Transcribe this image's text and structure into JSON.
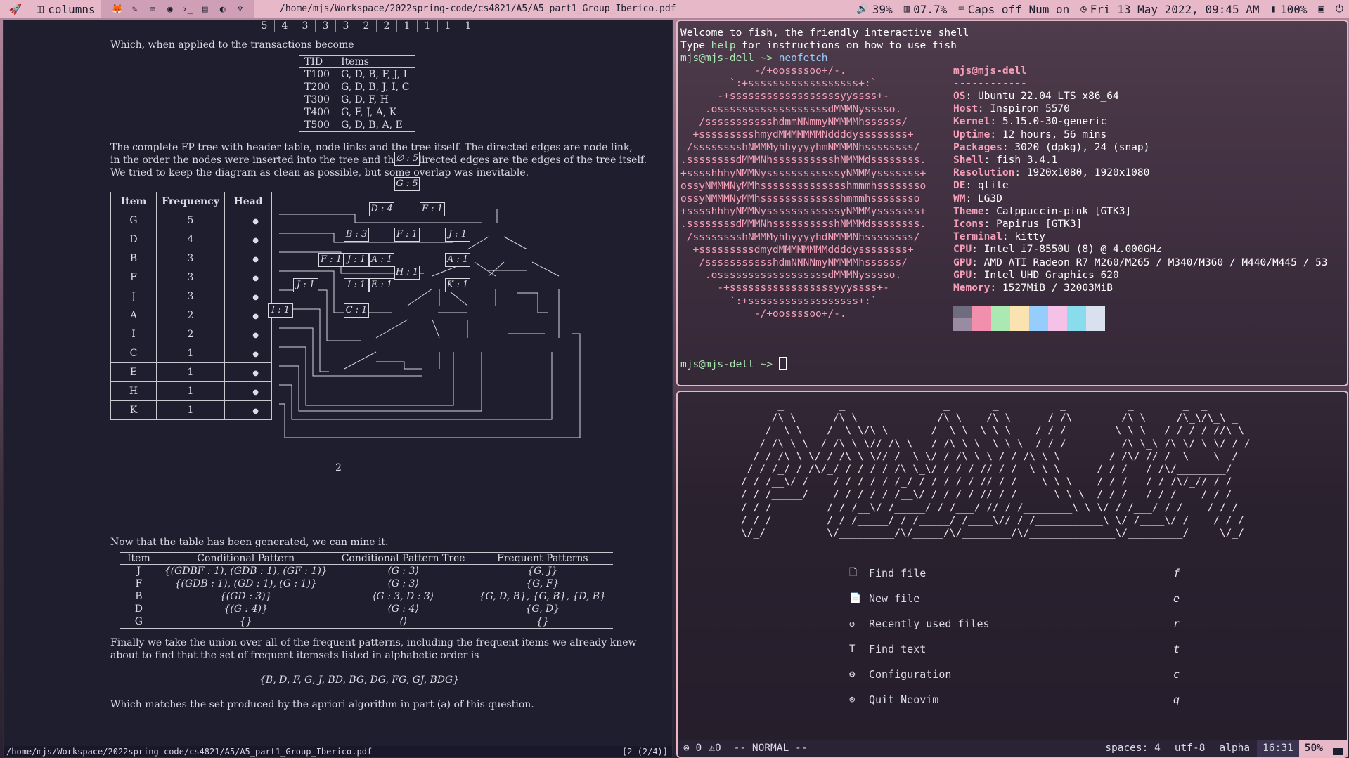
{
  "topbar": {
    "layout": "columns",
    "window_title": "/home/mjs/Workspace/2022spring-code/cs4821/A5/A5_part1_Group_Iberico.pdf",
    "volume": "39%",
    "memory": "07.7%",
    "locks": "Caps off Num on",
    "clock": "Fri 13 May 2022, 09:45 AM",
    "battery": "100%"
  },
  "pdf": {
    "strip_numbers": [
      "5",
      "4",
      "3",
      "3",
      "3",
      "2",
      "2",
      "1",
      "1",
      "1",
      "1"
    ],
    "p_intro": "Which, when applied to the transactions become",
    "tid_header": [
      "TID",
      "Items"
    ],
    "tid_rows": [
      [
        "T100",
        "G, D, B, F, J, I"
      ],
      [
        "T200",
        "G, D, B, J, I, C"
      ],
      [
        "T300",
        "G, D, F, H"
      ],
      [
        "T400",
        "G, F, J, A, K"
      ],
      [
        "T500",
        "G, D, B, A, E"
      ]
    ],
    "p_tree_1": "The complete FP tree with header table, node links and the tree itself.  The directed edges are node link,",
    "p_tree_2": "in the order the nodes were inserted into the tree and the undirected edges are the edges of the tree itself.",
    "p_tree_3": "We tried to keep the diagram as clean as possible, but some overlap was inevitable.",
    "header_table": {
      "cols": [
        "Item",
        "Frequency",
        "Head"
      ],
      "rows": [
        [
          "G",
          "5"
        ],
        [
          "D",
          "4"
        ],
        [
          "B",
          "3"
        ],
        [
          "F",
          "3"
        ],
        [
          "J",
          "3"
        ],
        [
          "A",
          "2"
        ],
        [
          "I",
          "2"
        ],
        [
          "C",
          "1"
        ],
        [
          "E",
          "1"
        ],
        [
          "H",
          "1"
        ],
        [
          "K",
          "1"
        ]
      ]
    },
    "tree_nodes": {
      "root": "∅ : 5",
      "g5": "G : 5",
      "d4": "D : 4",
      "f1a": "F : 1",
      "b3": "B : 3",
      "f1b": "F : 1",
      "j1a": "J : 1",
      "f1c": "F : 1",
      "j1b": "J : 1",
      "a1a": "A : 1",
      "a1b": "A : 1",
      "h1": "H : 1",
      "j1c": "J : 1",
      "i1a": "I : 1",
      "e1": "E : 1",
      "k1": "K : 1",
      "i1b": "I : 1",
      "c1": "C : 1"
    },
    "page_number": "2",
    "p_mine": "Now that the table has been generated, we can mine it.",
    "mine_header": [
      "Item",
      "Conditional Pattern",
      "Conditional Pattern Tree",
      "Frequent Patterns"
    ],
    "mine_rows": [
      [
        "J",
        "{(GDBF : 1), (GDB : 1), (GF : 1)}",
        "⟨G : 3⟩",
        "{G, J}"
      ],
      [
        "F",
        "{(GDB : 1), (GD : 1), (G : 1)}",
        "⟨G : 3⟩",
        "{G, F}"
      ],
      [
        "B",
        "{(GD : 3)}",
        "⟨G : 3, D : 3⟩",
        "{G, D, B}, {G, B}, {D, B}"
      ],
      [
        "D",
        "{(G : 4)}",
        "⟨G : 4⟩",
        "{G, D}"
      ],
      [
        "G",
        "{}",
        "⟨⟩",
        "{}"
      ]
    ],
    "p_final_1": "Finally we take the union over all of the frequent patterns, including the frequent items we already knew",
    "p_final_2": "about to find that the set of frequent itemsets listed in alphabetic order is",
    "final_set": "{B, D, F, G, J, BD, BG, DG, FG, GJ, BDG}",
    "p_match": "Which matches the set produced by the apriori algorithm in part (a) of this question.",
    "status_path": "/home/mjs/Workspace/2022spring-code/cs4821/A5/A5_part1_Group_Iberico.pdf",
    "status_page": "[2 (2/4)]"
  },
  "terminal": {
    "welcome": "Welcome to fish, the friendly interactive shell",
    "help_pre": "Type ",
    "help_word": "help",
    "help_post": " for instructions on how to use fish",
    "prompt": "mjs@mjs-dell ~> ",
    "command": "neofetch",
    "art": [
      "            -/+oossssoo+/-.",
      "        `:+ssssssssssssssssss+:`",
      "      -+ssssssssssssssssssyyssss+-",
      "    .ossssssssssssssssssdMMMNysssso.",
      "   /ssssssssssshdmmNNmmyNMMMMhssssss/",
      "  +ssssssssshmydMMMMMMMNddddyssssssss+",
      " /sssssssshNMMMyhhyyyyhmNMMMNhssssssss/",
      ".ssssssssdMMMNhsssssssssshNMMMdssssssss.",
      "+sssshhhyNMMNyssssssssssssyNMMMysssssss+",
      "ossyNMMMNyMMhsssssssssssssshmmmhssssssso",
      "ossyNMMMNyMMhssssssssssssshmmmhssssssso",
      "+sssshhhyNMMNyssssssssssssyNMMMysssssss+",
      ".ssssssssdMMMNhsssssssssshNMMMdssssssss.",
      " /sssssssshNMMMyhhyyyyhdNMMMNhssssssss/",
      "  +sssssssssdmydMMMMMMMMddddyssssssss+",
      "   /ssssssssssshdmNNNNmyNMMMMhssssss/",
      "    .ossssssssssssssssssdMMMNysssso.",
      "      -+sssssssssssssssssyyyssss+-",
      "        `:+ssssssssssssssssss+:`",
      "            -/+oossssoo+/-."
    ],
    "user_host": "mjs@mjs-dell",
    "sep": "------------",
    "info": [
      {
        "k": "OS",
        "v": "Ubuntu 22.04 LTS x86_64"
      },
      {
        "k": "Host",
        "v": "Inspiron 5570"
      },
      {
        "k": "Kernel",
        "v": "5.15.0-30-generic"
      },
      {
        "k": "Uptime",
        "v": "12 hours, 56 mins"
      },
      {
        "k": "Packages",
        "v": "3020 (dpkg), 24 (snap)"
      },
      {
        "k": "Shell",
        "v": "fish 3.4.1"
      },
      {
        "k": "Resolution",
        "v": "1920x1080, 1920x1080"
      },
      {
        "k": "DE",
        "v": "qtile"
      },
      {
        "k": "WM",
        "v": "LG3D"
      },
      {
        "k": "Theme",
        "v": "Catppuccin-pink [GTK3]"
      },
      {
        "k": "Icons",
        "v": "Papirus [GTK3]"
      },
      {
        "k": "Terminal",
        "v": "kitty"
      },
      {
        "k": "CPU",
        "v": "Intel i7-8550U (8) @ 4.000GHz"
      },
      {
        "k": "GPU",
        "v": "AMD ATI Radeon R7 M260/M265 / M340/M360 / M440/M445 / 53"
      },
      {
        "k": "GPU",
        "v": "Intel UHD Graphics 620"
      },
      {
        "k": "Memory",
        "v": "1527MiB / 32003MiB"
      }
    ],
    "swatch_colors": [
      "#6e6c7e",
      "#f28fad",
      "#abe9b3",
      "#fae3b0",
      "#96cdfb",
      "#f5c2e7",
      "#89dceb",
      "#d9e0ee",
      "#988ba2",
      "#f28fad",
      "#abe9b3",
      "#fae3b0",
      "#96cdfb",
      "#f5c2e7",
      "#89dceb",
      "#d9e0ee"
    ],
    "prompt2": "mjs@mjs-dell ~> "
  },
  "nvim": {
    "logo": [
      "      _         _                _       _          _          _        _  _",
      "     /\\ \\      /\\ \\             /\\ \\    /\\ \\      / /\\        /\\ \\     /\\_\\/\\_\\ _",
      "    /  \\ \\    /  \\_\\/\\ \\       /  \\ \\  \\ \\ \\    / / /        \\ \\ \\   / / / / //\\_\\",
      "   / /\\ \\ \\  / /\\ \\ \\// /\\ \\   / /\\ \\ \\  \\ \\ \\  / / /         /\\ \\_\\ /\\ \\/ \\ \\/ / /",
      "  / / /\\ \\_\\/ / /\\ \\_\\// /  \\ \\/ / /\\ \\_\\ / / /\\ \\ \\        / /\\/_// /  \\____\\__/",
      " / / /_/ / /\\/_/ / / / / /\\ \\_\\/ / / / // / /  \\ \\ \\      / / /   / /\\/________/",
      "/ / /__\\/ /    / / / / / /_/ / / / / / // / /    \\ \\ \\    / / /   / / /\\/_// / /",
      "/ / /_____/    / / / / / /__\\/ / / / / // / /      \\ \\ \\  / / /   / / /    / / /",
      "/ / /         / / /__\\/ /_____/ / /___/ // / /________\\ \\ \\/ / /___/ / /    / / /",
      "/ / /         / / /_____/ / /_____/ /____\\// / /___________\\ \\/ /____\\/ /    / / /",
      "\\/_/          \\/_________/\\/_____/\\/________/\\/______________\\/_________/     \\/_/"
    ],
    "menu": [
      {
        "label": "Find file",
        "key": "f"
      },
      {
        "label": "New file",
        "key": "e"
      },
      {
        "label": "Recently used files",
        "key": "r"
      },
      {
        "label": "Find text",
        "key": "t"
      },
      {
        "label": "Configuration",
        "key": "c"
      },
      {
        "label": "Quit Neovim",
        "key": "q"
      }
    ],
    "diag_errors": "0",
    "diag_warnings": "0",
    "mode": "-- NORMAL --",
    "spaces": "spaces: 4",
    "encoding": "utf-8",
    "scheme": "alpha",
    "position": "16:31",
    "percent": "50%"
  }
}
